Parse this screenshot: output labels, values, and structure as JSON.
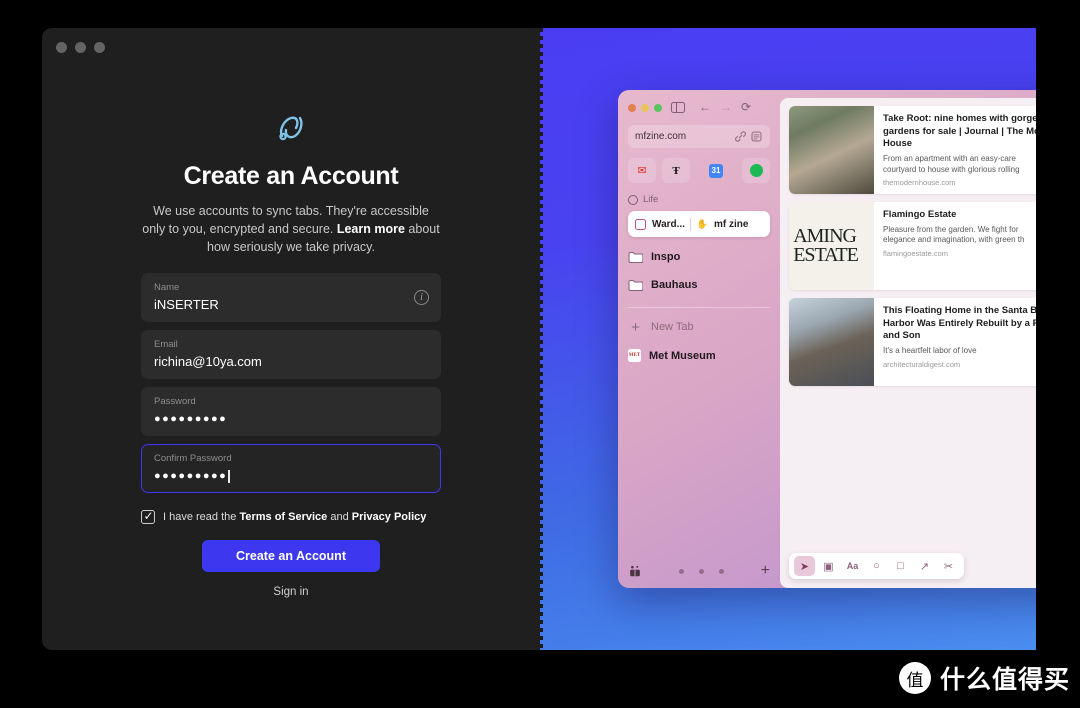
{
  "window": {
    "traffic_lights": [
      "close",
      "minimize",
      "zoom"
    ]
  },
  "signup": {
    "logo_icon": "arc-logo-icon",
    "title": "Create an Account",
    "subtitle_part1": "We use accounts to sync tabs. They're accessible only to you, encrypted and secure. ",
    "subtitle_link": "Learn more",
    "subtitle_part2": " about how seriously we take privacy.",
    "fields": [
      {
        "label": "Name",
        "value": "iNSERTER",
        "type": "text",
        "focused": false,
        "trailing_icon": "info-icon"
      },
      {
        "label": "Email",
        "value": "richina@10ya.com",
        "type": "email",
        "focused": false
      },
      {
        "label": "Password",
        "value": "●●●●●●●●●",
        "type": "password",
        "focused": false
      },
      {
        "label": "Confirm Password",
        "value": "●●●●●●●●●",
        "type": "password",
        "focused": true
      }
    ],
    "terms": {
      "checked": true,
      "text_before": "I have read the ",
      "link1": "Terms of Service",
      "text_middle": " and ",
      "link2": "Privacy Policy"
    },
    "cta_label": "Create an Account",
    "signin_label": "Sign in",
    "accent_color": "#3d37f0"
  },
  "promo": {
    "gradient_from": "#4b3ef2",
    "gradient_to": "#4a8df0",
    "browser": {
      "traffic_lights": [
        "#e0814f",
        "#e8c45c",
        "#5cc45c"
      ],
      "sidebar_toggle_icon": "sidebar-toggle-icon",
      "nav": {
        "back_icon": "arrow-left-icon",
        "forward_icon": "arrow-right-icon",
        "reload_icon": "reload-icon"
      },
      "url": "mfzine.com",
      "url_icons": [
        "link-icon",
        "reader-mode-icon"
      ],
      "favorites": [
        {
          "name": "gmail-favicon",
          "glyph": "✉",
          "color": "#d93025"
        },
        {
          "name": "nytimes-favicon",
          "glyph": "Ŧ",
          "color": "#1a1a1a"
        },
        {
          "name": "google-calendar-favicon",
          "glyph": "31",
          "color": "#4285f4"
        },
        {
          "name": "spotify-favicon",
          "glyph": "♫",
          "color": "#1db954"
        }
      ],
      "group_label": "Life",
      "tabs": [
        {
          "label": "Ward...",
          "favicon": "wardrobe-favicon"
        },
        {
          "label": "mf zine",
          "favicon": "mfzine-favicon"
        }
      ],
      "spaces": [
        {
          "label": "Inspo",
          "icon": "folder-icon"
        },
        {
          "label": "Bauhaus",
          "icon": "folder-icon"
        }
      ],
      "new_tab_label": "New Tab",
      "pinned": [
        {
          "label": "Met Museum",
          "icon": "met-museum-favicon"
        }
      ],
      "footer": {
        "gift_icon": "gift-icon",
        "page_dots": 3,
        "plus_icon": "plus-icon"
      },
      "cards": [
        {
          "title": "Take Root: nine homes with gorgeous\ngardens for sale | Journal | The Modern\nHouse",
          "description": "From an apartment with an easy-care\ncourtyard to house with glorious rolling",
          "url": "themodernhouse.com",
          "thumb": "house-garden-photo"
        },
        {
          "title": "Flamingo Estate",
          "description": "Pleasure from the garden. We fight for\nelegance and imagination, with green th",
          "url": "flamingoestate.com",
          "thumb": "flamingo-estate-wordmark",
          "thumb_text": "AMING\nESTATE"
        },
        {
          "title": "This Floating Home in the Santa Barbara\nHarbor Was Entirely Rebuilt by a Father\nand Son",
          "description": "It's a heartfelt labor of love",
          "url": "architecturaldigest.com",
          "thumb": "floating-home-photo"
        }
      ],
      "toolbar": [
        {
          "name": "cursor-tool",
          "glyph": "➤",
          "active": true
        },
        {
          "name": "image-tool",
          "glyph": "▣",
          "active": false
        },
        {
          "name": "text-tool",
          "glyph": "Aa",
          "active": false
        },
        {
          "name": "circle-tool",
          "glyph": "○",
          "active": false
        },
        {
          "name": "square-tool",
          "glyph": "□",
          "active": false
        },
        {
          "name": "arrow-tool",
          "glyph": "↗",
          "active": false
        },
        {
          "name": "eraser-tool",
          "glyph": "✂",
          "active": false
        }
      ]
    }
  },
  "watermark": {
    "badge": "值",
    "text": "什么值得买"
  }
}
